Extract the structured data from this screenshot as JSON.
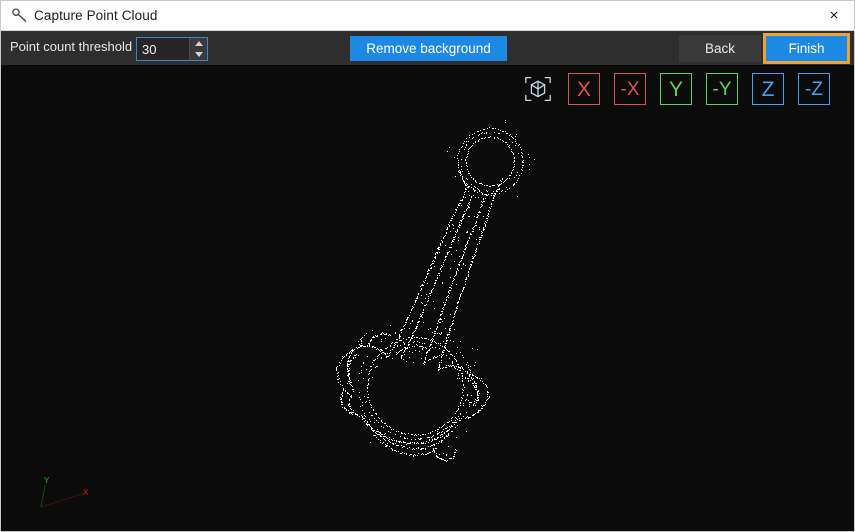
{
  "window": {
    "title": "Capture Point Cloud",
    "title_icon": "wrench-icon",
    "close_label": "×"
  },
  "toolbar": {
    "threshold_label": "Point count threshold",
    "threshold_value": "30",
    "threshold_placeholder": "30",
    "remove_background_label": "Remove background",
    "back_label": "Back",
    "finish_label": "Finish",
    "colors": {
      "toolbar_bg": "#2e2e2e",
      "primary_button": "#1e88e5",
      "focus_ring": "#e8a33d",
      "secondary_button": "#3a3a3a"
    }
  },
  "viewport": {
    "background": "#0b0b0b",
    "point_color": "#ffffff",
    "scene_description": "connecting-rod point cloud",
    "axis_buttons": [
      {
        "label": "",
        "name": "iso-view-button",
        "icon": "cube-icon",
        "color": "#bfd8e8",
        "kind": "iso"
      },
      {
        "label": "X",
        "name": "view-x-button",
        "color": "#d9534f",
        "kind": "x"
      },
      {
        "label": "-X",
        "name": "view-neg-x-button",
        "color": "#d9534f",
        "kind": "x"
      },
      {
        "label": "Y",
        "name": "view-y-button",
        "color": "#5ed15e",
        "kind": "y"
      },
      {
        "label": "-Y",
        "name": "view-neg-y-button",
        "color": "#5ed15e",
        "kind": "y"
      },
      {
        "label": "Z",
        "name": "view-z-button",
        "color": "#4a9eea",
        "kind": "z"
      },
      {
        "label": "-Z",
        "name": "view-neg-z-button",
        "color": "#4a9eea",
        "kind": "z"
      }
    ],
    "gizmo": {
      "x_label": "X",
      "y_label": "Y",
      "x_color": "#cc2222",
      "y_color": "#22bb22"
    }
  }
}
